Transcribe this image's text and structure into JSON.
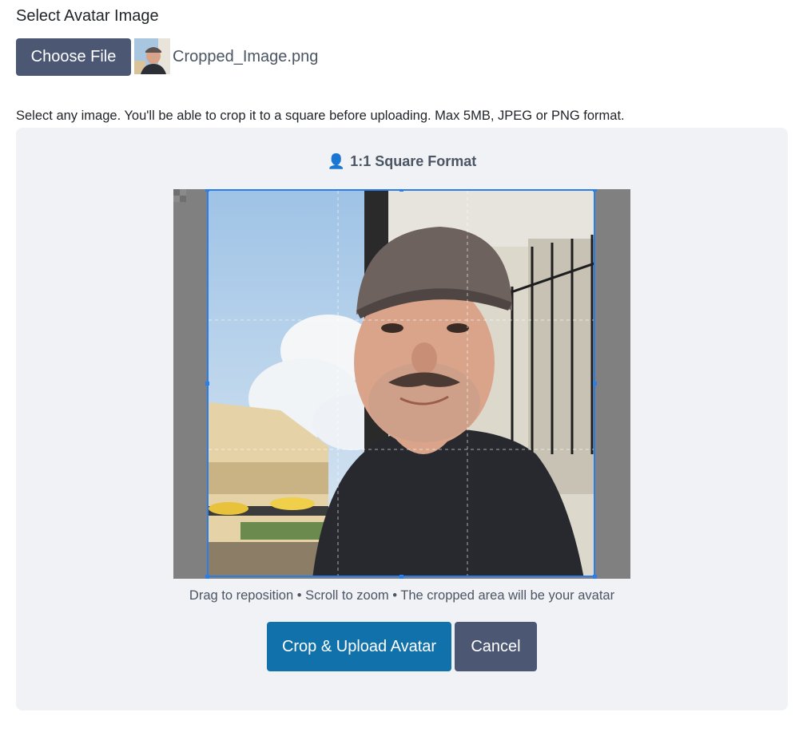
{
  "avatar_field": {
    "label": "Select Avatar Image",
    "choose_button": "Choose File",
    "file_name": "Cropped_Image.png",
    "help_text": "Select any image. You'll be able to crop it to a square before uploading. Max 5MB, JPEG or PNG format."
  },
  "cropper": {
    "format_icon": "person-icon",
    "format_glyph": "👤",
    "format_label": "1:1 Square Format",
    "hint": "Drag to reposition • Scroll to zoom • The cropped area will be your avatar",
    "accent_color": "#2b7de9"
  },
  "actions": {
    "upload_label": "Crop & Upload Avatar",
    "cancel_label": "Cancel",
    "upload_color": "#1172ab",
    "cancel_color": "#4b5773"
  }
}
